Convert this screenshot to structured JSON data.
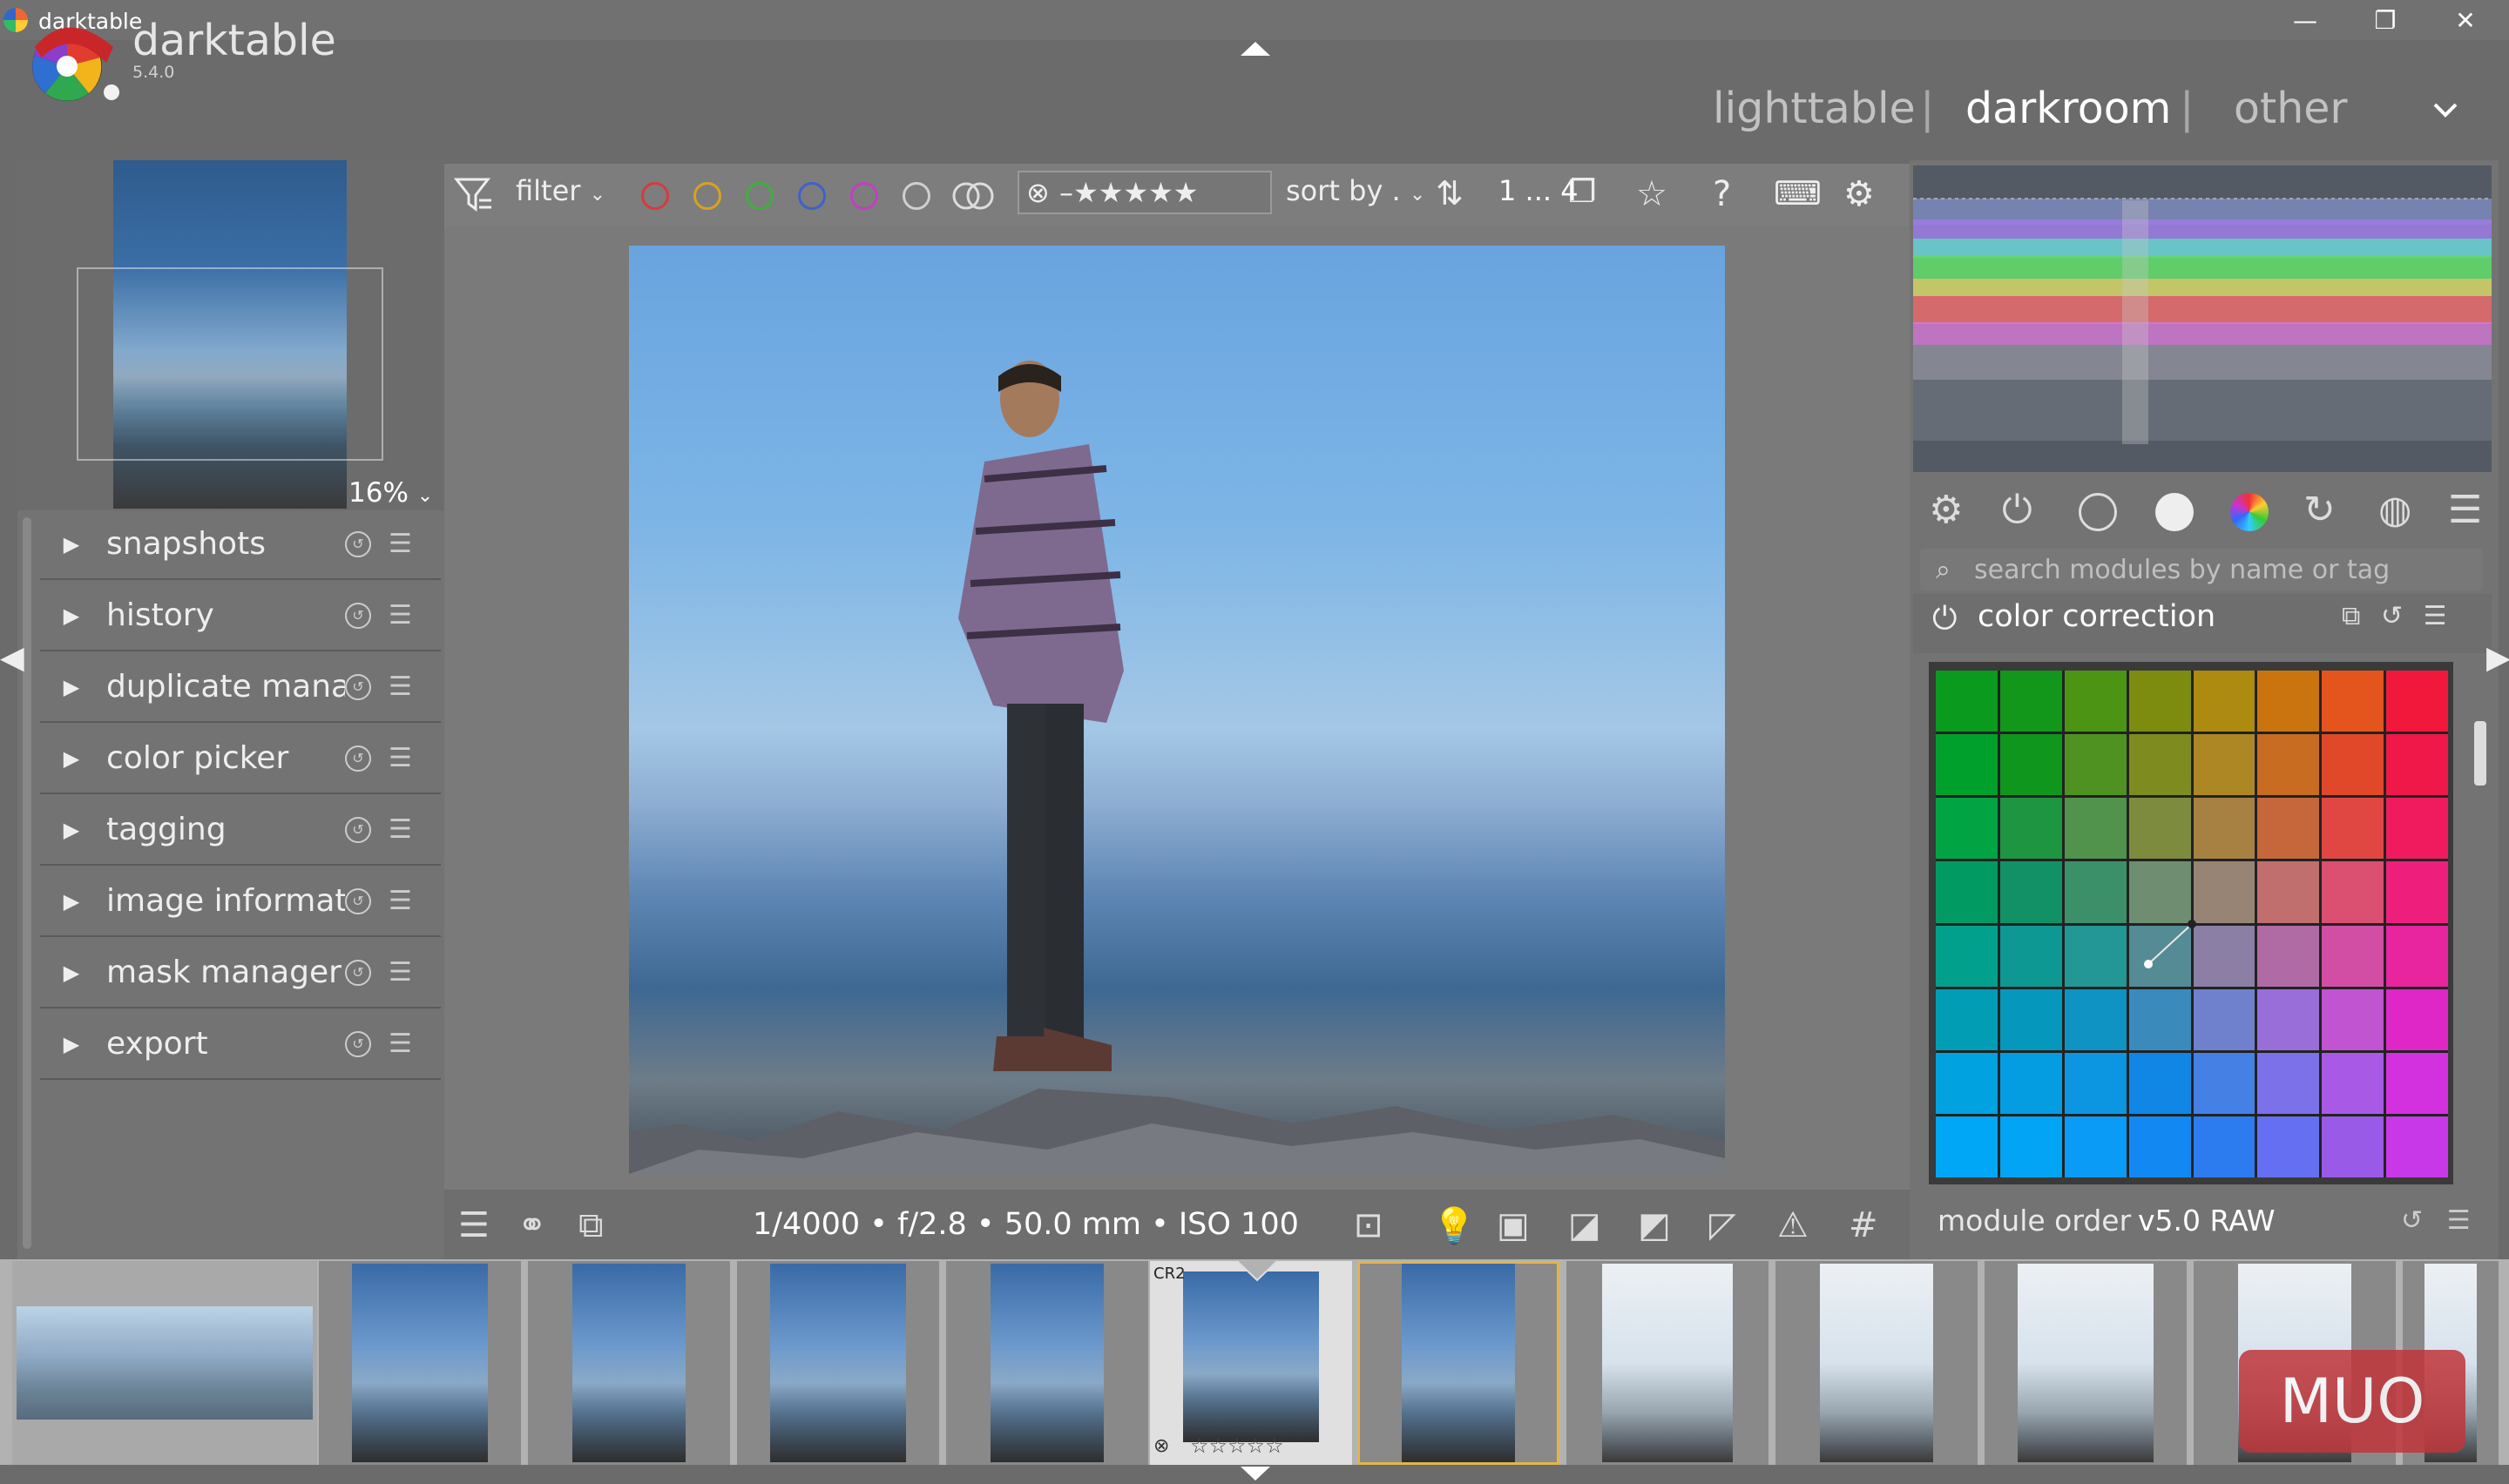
{
  "window": {
    "title": "darktable",
    "minimize": "—",
    "restore": "❐",
    "close": "✕"
  },
  "header": {
    "brand": "darktable",
    "version": "5.4.0",
    "views": [
      "lighttable",
      "darkroom",
      "other"
    ],
    "separator": "|",
    "active_view": "darkroom"
  },
  "navigation": {
    "zoom": "16%"
  },
  "left_modules": [
    {
      "label": "snapshots"
    },
    {
      "label": "history"
    },
    {
      "label": "duplicate mana..."
    },
    {
      "label": "color picker"
    },
    {
      "label": "tagging"
    },
    {
      "label": "image informati..."
    },
    {
      "label": "mask manager"
    },
    {
      "label": "export"
    }
  ],
  "toolbar": {
    "filter_label": "filter",
    "color_labels": [
      "#d63b3b",
      "#d9a21f",
      "#3fae3f",
      "#3f62c9",
      "#c23fc2",
      "#dddddd"
    ],
    "rating": "☆☆☆☆☆",
    "sort_label": "sort by .",
    "range": "1 ... 4"
  },
  "image_info": {
    "exif": "1/4000 • f/2.8 • 50.0 mm • ISO 100"
  },
  "right_panel": {
    "search_placeholder": "search modules by name or tag",
    "module_title": "color correction",
    "module_order_label": "module order",
    "module_order_value": "v5.0 RAW"
  },
  "color_grid": [
    [
      "#0a9a1e",
      "#12971a",
      "#4c9414",
      "#7d8c0f",
      "#ad8a10",
      "#c9740f",
      "#e4541d",
      "#f2183c"
    ],
    [
      "#00a02d",
      "#0f961d",
      "#4f9222",
      "#7e8c1f",
      "#ac8724",
      "#c86c22",
      "#e14729",
      "#f01848"
    ],
    [
      "#00a443",
      "#1e9541",
      "#51924c",
      "#7d8b3e",
      "#a68142",
      "#c5673a",
      "#e04743",
      "#f01b5e"
    ],
    [
      "#009a62",
      "#139166",
      "#3c9069",
      "#6f8e71",
      "#988475",
      "#c06e6e",
      "#db4f71",
      "#ee1f7c"
    ],
    [
      "#00a08c",
      "#0d9894",
      "#229795",
      "#548b95",
      "#8b7fa5",
      "#b06ba5",
      "#d24ea5",
      "#e8249f"
    ],
    [
      "#009db5",
      "#0698bc",
      "#0e93c3",
      "#3a8abc",
      "#6f80cd",
      "#9a6ed8",
      "#c054d1",
      "#de27c6"
    ],
    [
      "#00a2df",
      "#049de2",
      "#0c96e2",
      "#1087e5",
      "#4580e5",
      "#7d71ea",
      "#a85ae6",
      "#d331e0"
    ],
    [
      "#00a7f6",
      "#02a4f5",
      "#0a9bf6",
      "#1289f2",
      "#2c7cf0",
      "#6470f1",
      "#9a5ae8",
      "#c838e8"
    ]
  ],
  "filmstrip": {
    "badge": "CR2",
    "rating": "☆☆☆☆☆"
  },
  "watermark": "MUO"
}
